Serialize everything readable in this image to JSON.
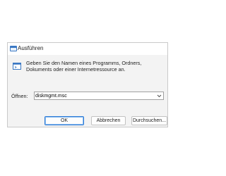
{
  "window": {
    "title": "Ausführen",
    "message": "Geben Sie den Namen eines Programms, Ordners, Dokuments oder einer Internetressource an.",
    "open_label": "Öffnen:",
    "command_value": "diskmgmt.msc",
    "buttons": {
      "ok": "OK",
      "cancel": "Abbrechen",
      "browse": "Durchsuchen..."
    }
  },
  "icons": {
    "title": "run-window-icon",
    "body": "run-window-icon",
    "dropdown": "chevron-down-icon"
  },
  "colors": {
    "accent": "#2d7bd6",
    "window_bg": "#f3f3f3",
    "titlebar_bg": "#ffffff"
  }
}
